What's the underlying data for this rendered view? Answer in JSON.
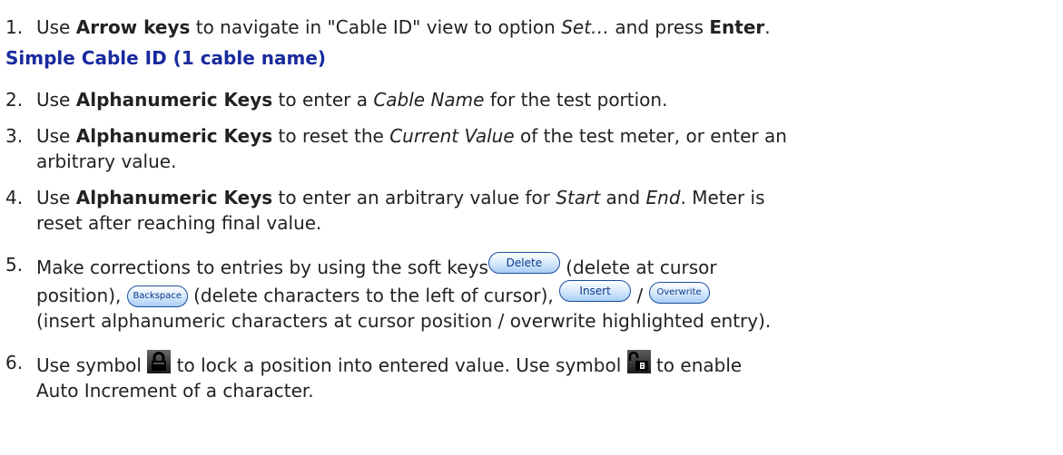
{
  "steps": [
    {
      "num": "1.",
      "t1": "Use ",
      "b1": "Arrow keys",
      "t2": " to navigate in \"Cable ID\" view to option ",
      "i1": "Set…",
      "t3": " and press ",
      "b2": "Enter",
      "t4": "."
    },
    {
      "num": "2.",
      "t1": "Use ",
      "b1": "Alphanumeric Keys",
      "t2": " to enter a ",
      "i1": "Cable Name",
      "t3": " for the test portion."
    },
    {
      "num": "3.",
      "t1": "Use ",
      "b1": "Alphanumeric Keys",
      "t2": " to reset the ",
      "i1": "Current Value",
      "t3": " of the test meter, or enter an",
      "t4": "arbitrary value."
    },
    {
      "num": "4.",
      "t1": "Use ",
      "b1": "Alphanumeric Keys",
      "t2": " to enter an arbitrary value for ",
      "i1": "Start",
      "t3": " and ",
      "i2": "End",
      "t4": ". Meter is",
      "t5": "reset after reaching final value."
    },
    {
      "num": "5.",
      "t1": "Make corrections to entries by using the soft keys",
      "t2": " (delete at cursor",
      "t3": "position), ",
      "t4": " (delete characters to the left of cursor), ",
      "t5": " / ",
      "t6": "(insert alphanumeric characters at cursor position / overwrite highlighted entry)."
    },
    {
      "num": "6.",
      "t1": "Use symbol ",
      "t2": " to lock a position into entered value. Use symbol ",
      "t3": " to enable",
      "t4": "Auto Increment of a character."
    }
  ],
  "section_title": "Simple Cable ID (1 cable name)",
  "softkeys": {
    "delete": "Delete",
    "backspace": "Backspace",
    "insert": "Insert",
    "overwrite": "Overwrite"
  },
  "colors": {
    "section_title": "#1a2a9e",
    "softkey_border": "#1c4ea0"
  },
  "icons": {
    "lock": "lock-icon",
    "auto_increment": "auto-increment-icon"
  }
}
